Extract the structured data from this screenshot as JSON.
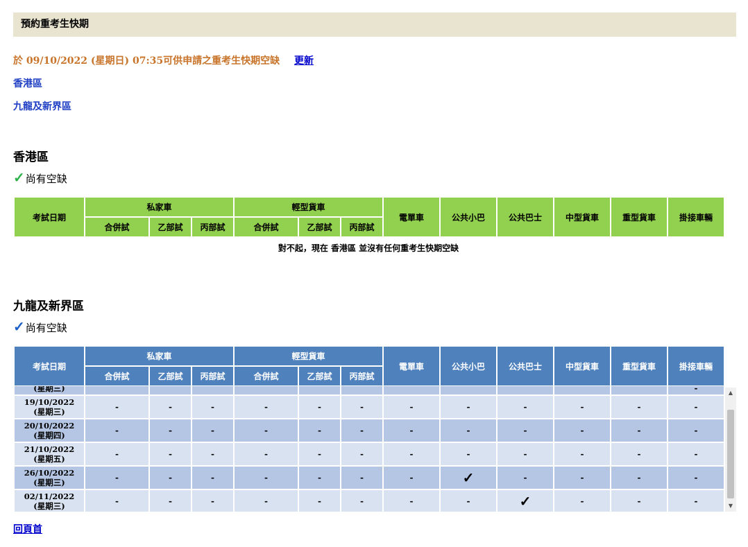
{
  "page_title": "預約重考生快期",
  "update": {
    "text": "於 09/10/2022 (星期日) 07:35可供申請之重考生快期空缺",
    "refresh_label": "更新"
  },
  "nav": {
    "hk": "香港區",
    "kl": "九龍及新界區"
  },
  "hk_section": {
    "title": "香港區",
    "avail_check": "✓",
    "avail_text": "尚有空缺",
    "no_slot_msg": "對不起，現在 香港區 並沒有任何重考生快期空缺",
    "colors": {
      "header_bg": "#92d050",
      "check": "#2db34a"
    }
  },
  "kl_section": {
    "title": "九龍及新界區",
    "avail_check": "✓",
    "avail_text": "尚有空缺",
    "colors": {
      "header_bg": "#4f81bd",
      "check": "#1a5fc7"
    }
  },
  "headers": {
    "date": "考試日期",
    "private_car": "私家車",
    "light_goods": "輕型貨車",
    "motorcycle": "電單車",
    "public_light_bus": "公共小巴",
    "public_bus": "公共巴士",
    "medium_goods": "中型貨車",
    "heavy_goods": "重型貨車",
    "articulated": "掛接車輛",
    "combined": "合併試",
    "part_b": "乙部試",
    "part_c": "丙部試"
  },
  "kl_rows": [
    {
      "date": "(星期三)",
      "day": "",
      "cells": [
        "",
        "",
        "",
        "",
        "",
        "",
        "",
        "",
        "",
        "",
        "",
        "-"
      ]
    },
    {
      "date": "19/10/2022",
      "day": "(星期三)",
      "cells": [
        "-",
        "-",
        "-",
        "-",
        "-",
        "-",
        "-",
        "-",
        "-",
        "-",
        "-",
        "-"
      ]
    },
    {
      "date": "20/10/2022",
      "day": "(星期四)",
      "cells": [
        "-",
        "-",
        "-",
        "-",
        "-",
        "-",
        "-",
        "-",
        "-",
        "-",
        "-",
        "-"
      ]
    },
    {
      "date": "21/10/2022",
      "day": "(星期五)",
      "cells": [
        "-",
        "-",
        "-",
        "-",
        "-",
        "-",
        "-",
        "-",
        "-",
        "-",
        "-",
        "-"
      ]
    },
    {
      "date": "26/10/2022",
      "day": "(星期三)",
      "cells": [
        "-",
        "-",
        "-",
        "-",
        "-",
        "-",
        "-",
        "✓",
        "-",
        "-",
        "-",
        "-"
      ]
    },
    {
      "date": "02/11/2022",
      "day": "(星期三)",
      "cells": [
        "-",
        "-",
        "-",
        "-",
        "-",
        "-",
        "-",
        "-",
        "✓",
        "-",
        "-",
        "-"
      ]
    }
  ],
  "back_link": "回頁首"
}
